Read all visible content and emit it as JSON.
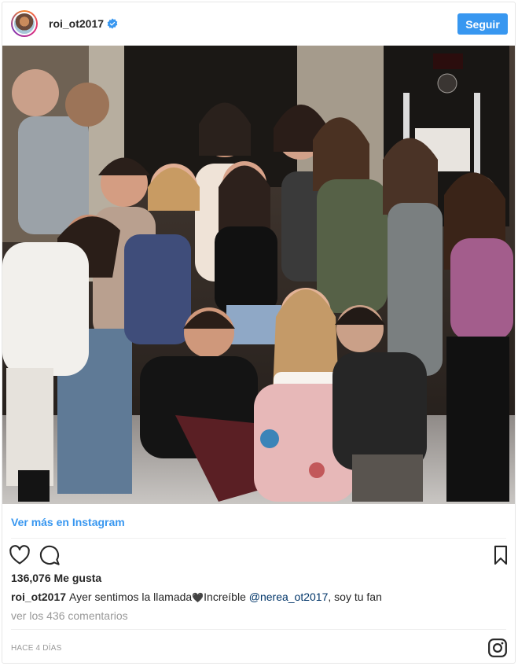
{
  "header": {
    "username": "roi_ot2017",
    "follow_label": "Seguir"
  },
  "photo": {
    "alt_subject": ""
  },
  "footer": {
    "more_link": "Ver más en Instagram",
    "likes": "136,076 Me gusta",
    "caption_user": "roi_ot2017",
    "caption_text_before": "Ayer sentimos la llamada",
    "caption_heart": "🖤",
    "caption_text_after": "Increíble ",
    "caption_mention": "@nerea_ot2017",
    "caption_text_end": ", soy tu fan",
    "comments_link": "ver los 436 comentarios",
    "timestamp": "HACE 4 DÍAS"
  },
  "colors": {
    "accent": "#3897f0",
    "mention": "#003569",
    "muted": "#999999"
  },
  "icons": {
    "verified": "verified-badge-icon",
    "like": "heart-icon",
    "comment": "comment-bubble-icon",
    "save": "bookmark-icon",
    "brand": "instagram-icon"
  }
}
